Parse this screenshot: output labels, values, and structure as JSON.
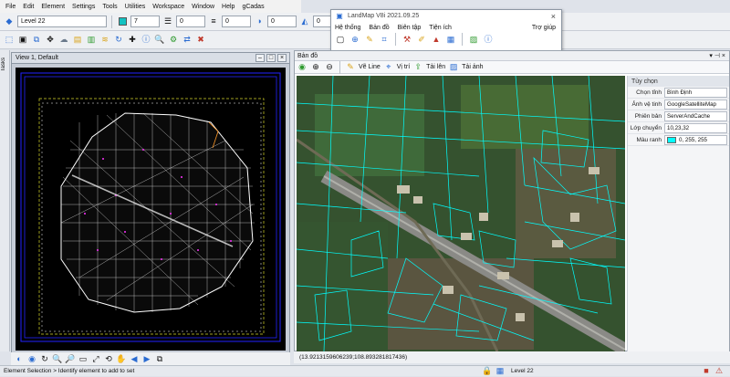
{
  "menu": [
    "File",
    "Edit",
    "Element",
    "Settings",
    "Tools",
    "Utilities",
    "Workspace",
    "Window",
    "Help",
    "gCadas"
  ],
  "toolbar": {
    "level": "Level 22",
    "color_num": "7",
    "style_num": "0",
    "weight_num": "0",
    "trans_num": "0",
    "priority_num": "0"
  },
  "tasks_label": "Tasks",
  "view": {
    "title": "View 1, Default"
  },
  "landmap": {
    "title": "LandMap V8i 2021.09.25",
    "menu": [
      "Hệ thống",
      "Bản đồ",
      "Biên tập",
      "Tiện ích"
    ],
    "help": "Trợ giúp"
  },
  "panel": {
    "title": "Bản đồ",
    "tools": [
      "Vẽ Line",
      "Vị trí",
      "Tải lên",
      "Tải ảnh"
    ]
  },
  "props": {
    "header": "Tùy chọn",
    "rows": [
      {
        "key": "Chọn tỉnh",
        "value": "Bình Định"
      },
      {
        "key": "Ảnh vệ tinh",
        "value": "GoogleSatelliteMap"
      },
      {
        "key": "Phiên bản",
        "value": "ServerAndCache"
      },
      {
        "key": "Lớp chuyển",
        "value": "10,23,32"
      },
      {
        "key": "Màu ranh",
        "value": "0, 255, 255"
      }
    ],
    "border_color": "#00ffff"
  },
  "coord_text": "(13.9213159606239;108.893281817436)",
  "status": {
    "left": "Element Selection > Identify element to add to set",
    "level": "Level 22"
  }
}
